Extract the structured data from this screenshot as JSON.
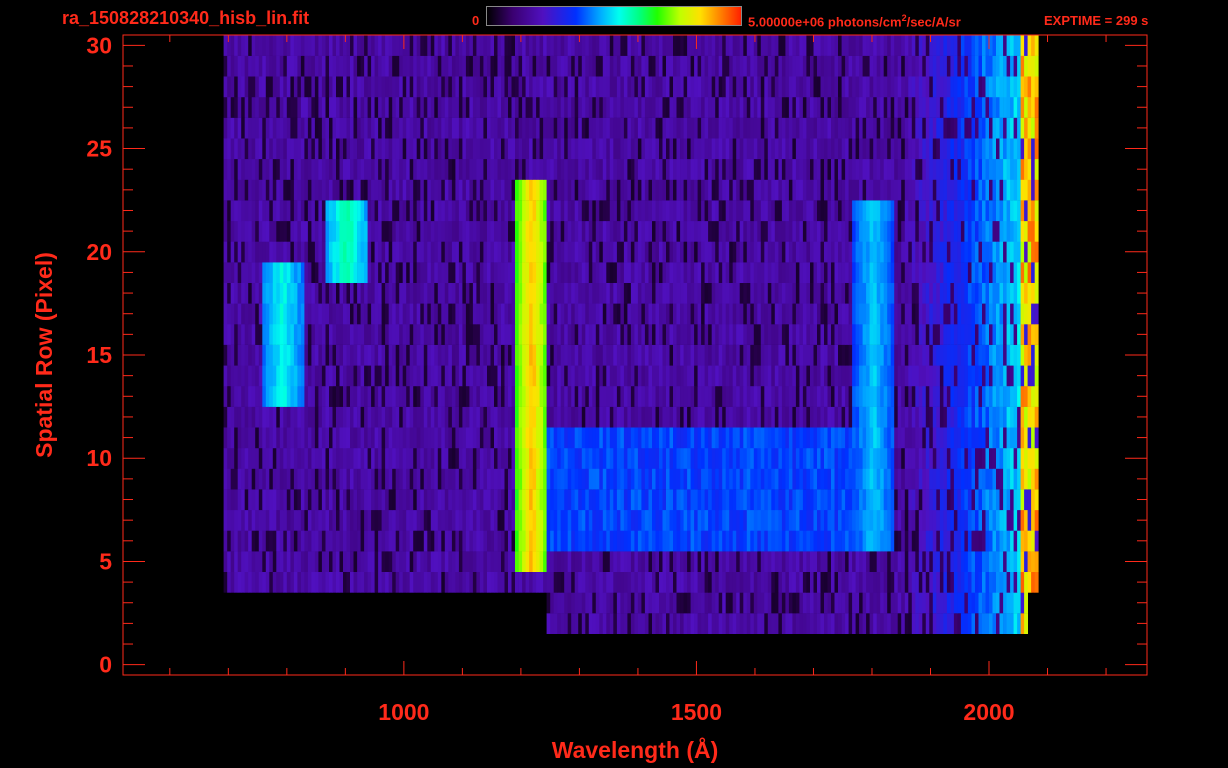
{
  "header": {
    "filename": "ra_150828210340_hisb_lin.fit",
    "colorbar_min": "0",
    "colorbar_max_prefix": "5.00000e+06 photons/cm",
    "colorbar_max_sup": "2",
    "colorbar_max_suffix": "/sec/A/sr",
    "exptime": "EXPTIME = 299 s"
  },
  "colors": {
    "accent": "#ff2a1a",
    "background": "#000000"
  },
  "chart_data": {
    "type": "heatmap",
    "title": "ra_150828210340_hisb_lin.fit",
    "xlabel": "Wavelength (Å)",
    "ylabel": "Spatial Row (Pixel)",
    "xlim": [
      520,
      2270
    ],
    "ylim": [
      -0.5,
      30.5
    ],
    "xticks": [
      1000,
      1500,
      2000
    ],
    "yticks": [
      0,
      5,
      10,
      15,
      20,
      25,
      30
    ],
    "colorbar": {
      "min": 0,
      "max": 5000000,
      "units": "photons/cm²/sec/A/sr"
    },
    "features": [
      {
        "wavelength": 1216,
        "rows": [
          5,
          23
        ],
        "intensity": 0.85
      },
      {
        "wavelength": 790,
        "rows": [
          13,
          19
        ],
        "intensity": 0.5
      },
      {
        "wavelength": 900,
        "rows": [
          19,
          22
        ],
        "intensity": 0.55
      },
      {
        "wavelength": 1800,
        "rows": [
          6,
          22
        ],
        "intensity": 0.45
      },
      {
        "wavelength_range": [
          1216,
          1800
        ],
        "rows": [
          6,
          11
        ],
        "intensity": 0.4
      }
    ]
  }
}
